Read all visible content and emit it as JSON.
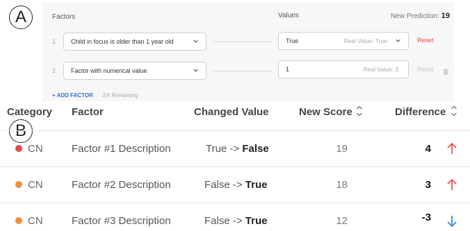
{
  "labels": {
    "a": "A",
    "b": "B"
  },
  "panel": {
    "factors_header": "Factors",
    "values_header": "Values",
    "new_prediction_label": "New Prediction:",
    "new_prediction_value": "19",
    "rows": [
      {
        "index": "1",
        "factor": "Child in focus is older than 1 year old",
        "value": "True",
        "real_value": "Real Value: True",
        "reset": "Reset"
      },
      {
        "index": "2",
        "factor": "Factor with numerical value",
        "value": "1",
        "real_value": "Real Value: 3",
        "reset": "Reset"
      }
    ],
    "add_factor": "+ ADD FACTOR",
    "remaining": "2/4 Remaining"
  },
  "table": {
    "headers": {
      "category": "Category",
      "factor": "Factor",
      "changed_value": "Changed Value",
      "new_score": "New Score",
      "difference": "Difference"
    },
    "rows": [
      {
        "category": "CN",
        "dot_color": "#e04a4a",
        "factor": "Factor #1 Description",
        "changed_from": "True ->",
        "changed_to": "False",
        "new_score": "19",
        "difference": "4",
        "trend": "up",
        "trend_color": "#f0524f"
      },
      {
        "category": "CN",
        "dot_color": "#f0923a",
        "factor": "Factor #2 Description",
        "changed_from": "False ->",
        "changed_to": "True",
        "new_score": "18",
        "difference": "3",
        "trend": "up",
        "trend_color": "#f0524f"
      },
      {
        "category": "CN",
        "dot_color": "#f0923a",
        "factor": "Factor #3 Description",
        "changed_from": "False ->",
        "changed_to": "True",
        "new_score": "12",
        "difference": "-3",
        "trend": "down",
        "trend_color": "#3b8de0"
      }
    ]
  },
  "icons": {
    "sort": "sort-updown-icon",
    "arrow_up": "arrow-up-icon",
    "arrow_down": "arrow-down-icon",
    "chevron": "chevron-down-icon",
    "trash": "trash-icon"
  }
}
